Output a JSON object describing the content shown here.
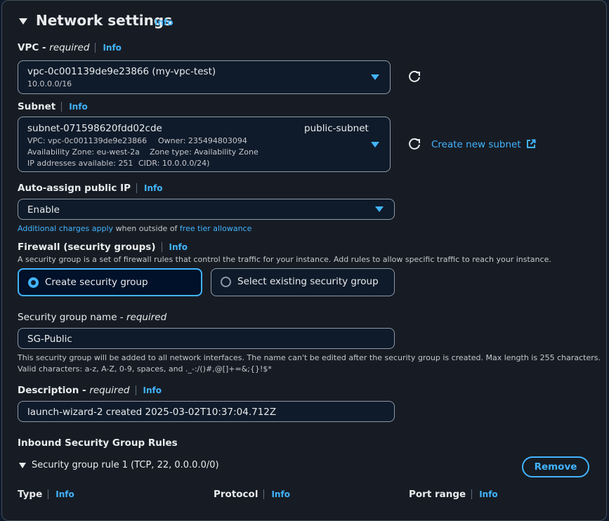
{
  "section": {
    "title": "Network settings",
    "info": "Info"
  },
  "vpc": {
    "label": "VPC",
    "required": "required",
    "info": "Info",
    "value": "vpc-0c001139de9e23866 (my-vpc-test)",
    "cidr": "10.0.0.0/16"
  },
  "subnet": {
    "label": "Subnet",
    "info": "Info",
    "value": "subnet-071598620fdd02cde",
    "name": "public-subnet",
    "vpc_line": "VPC: vpc-0c001139de9e23866",
    "owner_line": "Owner: 235494803094",
    "az_line": "Availability Zone: eu-west-2a",
    "zone_type_line": "Zone type: Availability Zone",
    "ips_line": "IP addresses available: 251",
    "cidr_line": "CIDR: 10.0.0.0/24)",
    "create_link": "Create new subnet"
  },
  "auto_ip": {
    "label": "Auto-assign public IP",
    "info": "Info",
    "value": "Enable",
    "charges_link": "Additional charges apply",
    "charges_mid": "when outside of",
    "free_tier_link": "free tier allowance"
  },
  "firewall": {
    "label": "Firewall (security groups)",
    "info": "Info",
    "description": "A security group is a set of firewall rules that control the traffic for your instance. Add rules to allow specific traffic to reach your instance.",
    "option_create": "Create security group",
    "option_existing": "Select existing security group"
  },
  "sg_name": {
    "label": "Security group name -",
    "required": "required",
    "value": "SG-Public",
    "help1": "This security group will be added to all network interfaces. The name can't be edited after the security group is created. Max length is 255 characters.",
    "help2": "Valid characters: a-z, A-Z, 0-9, spaces, and ._-:/()#,@[]+=&;{}!$*"
  },
  "description": {
    "label": "Description -",
    "required": "required",
    "info": "Info",
    "value": "launch-wizard-2 created 2025-03-02T10:37:04.712Z"
  },
  "inbound": {
    "title": "Inbound Security Group Rules",
    "rule1": "Security group rule 1 (TCP, 22, 0.0.0.0/0)",
    "remove": "Remove",
    "type_label": "Type",
    "protocol_label": "Protocol",
    "port_label": "Port range",
    "info": "Info"
  },
  "colors": {
    "accent": "#42b4ff",
    "panel": "#171c24",
    "border": "#8d99a8"
  }
}
